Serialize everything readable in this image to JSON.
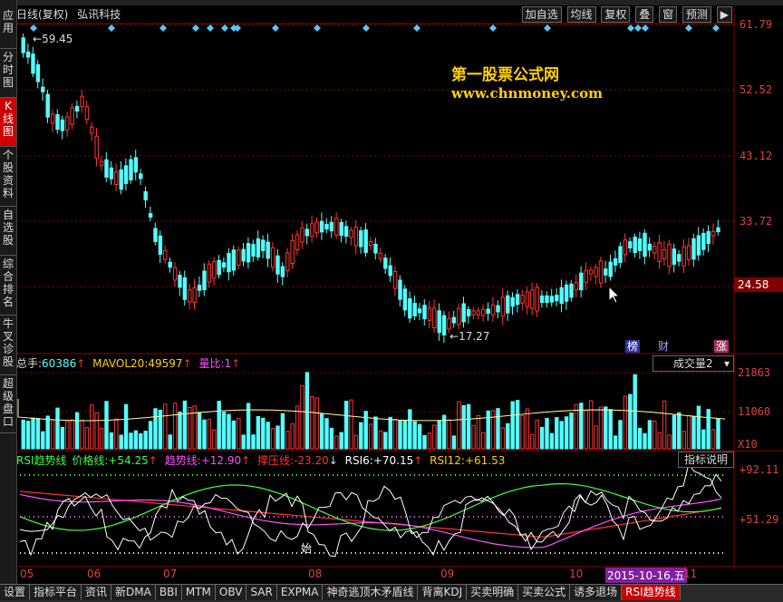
{
  "app": {
    "title_mode": "日线(复权)",
    "stock_name": "弘讯科技"
  },
  "toolbar": {
    "buttons": [
      "加自选",
      "均线",
      "复权",
      "叠",
      "窗",
      "预测"
    ],
    "expand_label": "▶"
  },
  "sidebar": {
    "items": [
      {
        "label": "应\n用",
        "active": false
      },
      {
        "label": "分\n时\n图",
        "active": false
      },
      {
        "label": "K\n线\n图",
        "active": true
      },
      {
        "label": "个\n股\n资\n料",
        "active": false
      },
      {
        "label": "自\n选\n股",
        "active": false
      },
      {
        "label": "综\n合\n排\n名",
        "active": false
      },
      {
        "label": "牛\n叉\n诊\n股",
        "active": false
      },
      {
        "label": "超\n级\n盘\n口",
        "active": false
      }
    ]
  },
  "watermark": {
    "line1": "第一股票公式网",
    "line2": "www.chnmoney.com"
  },
  "price_axis": {
    "labels": [
      "61.79",
      "52.52",
      "43.12",
      "33.72",
      "24.58"
    ],
    "current_price": "24.58",
    "high_marker": "59.45",
    "low_marker": "17.27"
  },
  "signals": {
    "bang": "榜",
    "cai": "财",
    "zhang": "涨"
  },
  "volume": {
    "header_label": "总手:",
    "header_value": "60386",
    "mavol_label": "MAVOL20:",
    "mavol_value": "49597",
    "ratio_label": "量比:",
    "ratio_value": "1",
    "selector": "成交量2",
    "axis_labels": [
      "21863",
      "11060",
      "X10"
    ]
  },
  "rsi": {
    "name": "RSI趋势线",
    "price_line_label": "价格线:",
    "price_line_value": "+54.25",
    "trend_line_label": "趋势线:",
    "trend_line_value": "+12.90",
    "pressure_label": "撑压线:",
    "pressure_value": "-23.20",
    "rsi6_label": "RSI6:",
    "rsi6_value": "+70.15",
    "rsi12_label": "RSI12:",
    "rsi12_value": "+61.53",
    "help_button": "指标说明",
    "axis_labels": [
      "+92.11",
      "+51.29"
    ],
    "annotation": "始"
  },
  "xaxis": {
    "months": [
      "05",
      "06",
      "07",
      "08",
      "09",
      "10",
      "11"
    ],
    "cursor_date": "2015-10-16,五"
  },
  "bottom_tabs": [
    "设置",
    "指标平台",
    "资讯",
    "新DMA",
    "BBI",
    "MTM",
    "OBV",
    "SAR",
    "EXPMA",
    "神奇逃顶木矛盾线",
    "背离KDJ",
    "买卖明确",
    "买卖公式",
    "诱多退场",
    "RSI趋势线"
  ],
  "active_tab": "RSI趋势线",
  "colors": {
    "up": "#ff3232",
    "down": "#54ffff",
    "background": "#000000",
    "grid": "#8b0000",
    "accent_yellow": "#ffd200"
  }
}
